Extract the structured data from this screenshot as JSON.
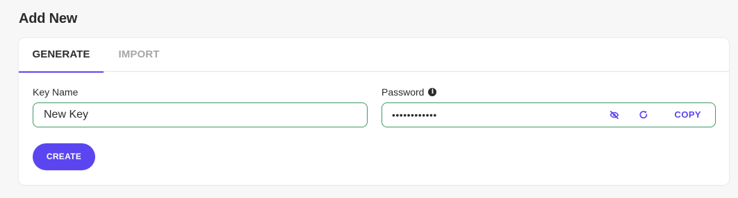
{
  "section": {
    "title": "Add New"
  },
  "tabs": [
    {
      "label": "GENERATE",
      "active": true
    },
    {
      "label": "IMPORT",
      "active": false
    }
  ],
  "form": {
    "key_name": {
      "label": "Key Name",
      "value": "New Key"
    },
    "password": {
      "label": "Password",
      "masked_value": "••••••••••••",
      "visibility_icon": "eye-slash-icon",
      "refresh_icon": "refresh-icon",
      "info_icon": "info-icon",
      "copy_label": "COPY"
    },
    "create_label": "CREATE"
  },
  "colors": {
    "accent": "#5b45f0",
    "input_border": "#3b9a62",
    "background": "#f7f7f7"
  }
}
